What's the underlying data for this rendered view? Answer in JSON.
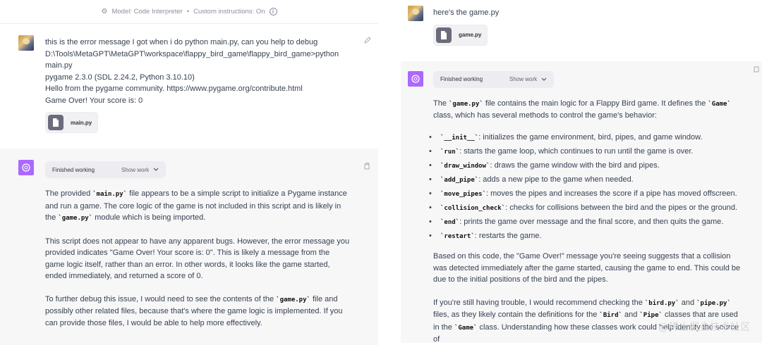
{
  "left": {
    "model_bar": {
      "model": "Model: Code Interpreter",
      "separator": "•",
      "custom": "Custom instructions: On"
    },
    "user_message": {
      "lines": [
        "this is the error message I got when i do python main.py, can you help to debug",
        "D:\\Tools\\MetaGPT\\MetaGPT\\workspace\\flappy_bird_game\\flappy_bird_game>python",
        "main.py",
        "pygame 2.3.0 (SDL 2.24.2, Python 3.10.10)",
        "Hello from the pygame community. https://www.pygame.org/contribute.html",
        "Game Over! Your score is:  0"
      ],
      "file_name": "main.py"
    },
    "assistant_message": {
      "working_label": "Finished working",
      "show_work_label": "Show work",
      "p1": {
        "a": "The provided ",
        "code1": "`main.py`",
        "b": " file appears to be a simple script to initialize a Pygame instance and run a game. The core logic of the game is not included in this script and is likely in the ",
        "code2": "`game.py`",
        "c": " module which is being imported."
      },
      "p2": "This script does not appear to have any apparent bugs. However, the error message you provided indicates \"Game Over! Your score is: 0\". This is likely a message from the game logic itself, rather than an error. In other words, it looks like the game started, ended immediately, and returned a score of 0.",
      "p3": {
        "a": "To further debug this issue, I would need to see the contents of the ",
        "code1": "`game.py`",
        "b": " file and possibly other related files, because that's where the game logic is implemented. If you can provide those files, I would be able to help more effectively."
      }
    }
  },
  "right": {
    "user_message": {
      "text": "here's the game.py",
      "file_name": "game.py"
    },
    "assistant_message": {
      "working_label": "Finished working",
      "show_work_label": "Show work",
      "intro": {
        "a": "The ",
        "code1": "`game.py`",
        "b": " file contains the main logic for a Flappy Bird game. It defines the ",
        "code2": "`Game`",
        "c": " class, which has several methods to control the game's behavior:"
      },
      "bullets": [
        {
          "code": "`__init__`",
          "text": ": initializes the game environment, bird, pipes, and game window."
        },
        {
          "code": "`run`",
          "text": ": starts the game loop, which continues to run until the game is over."
        },
        {
          "code": "`draw_window`",
          "text": ": draws the game window with the bird and pipes."
        },
        {
          "code": "`add_pipe`",
          "text": ": adds a new pipe to the game when needed."
        },
        {
          "code": "`move_pipes`",
          "text": ": moves the pipes and increases the score if a pipe has moved offscreen."
        },
        {
          "code": "`collision_check`",
          "text": ": checks for collisions between the bird and the pipes or the ground."
        },
        {
          "code": "`end`",
          "text": ": prints the game over message and the final score, and then quits the game."
        },
        {
          "code": "`restart`",
          "text": ": restarts the game."
        }
      ],
      "p2": "Based on this code, the \"Game Over!\" message you're seeing suggests that a collision was detected immediately after the game started, causing the game to end. This could be due to the initial positions of the bird and the pipes.",
      "p3": {
        "a": "If you're still having trouble, I would recommend checking the ",
        "code1": "`bird.py`",
        "b": " and ",
        "code2": "`pipe.py`",
        "c": " files, as they likely contain the definitions for the ",
        "code3": "`Bird`",
        "d": " and ",
        "code4": "`Pipe`",
        "e": " classes that are used in the ",
        "code5": "`Game`",
        "f": " class. Understanding how these classes work could help identify the source of"
      }
    }
  },
  "watermark": "@稀土掘金技术社区"
}
